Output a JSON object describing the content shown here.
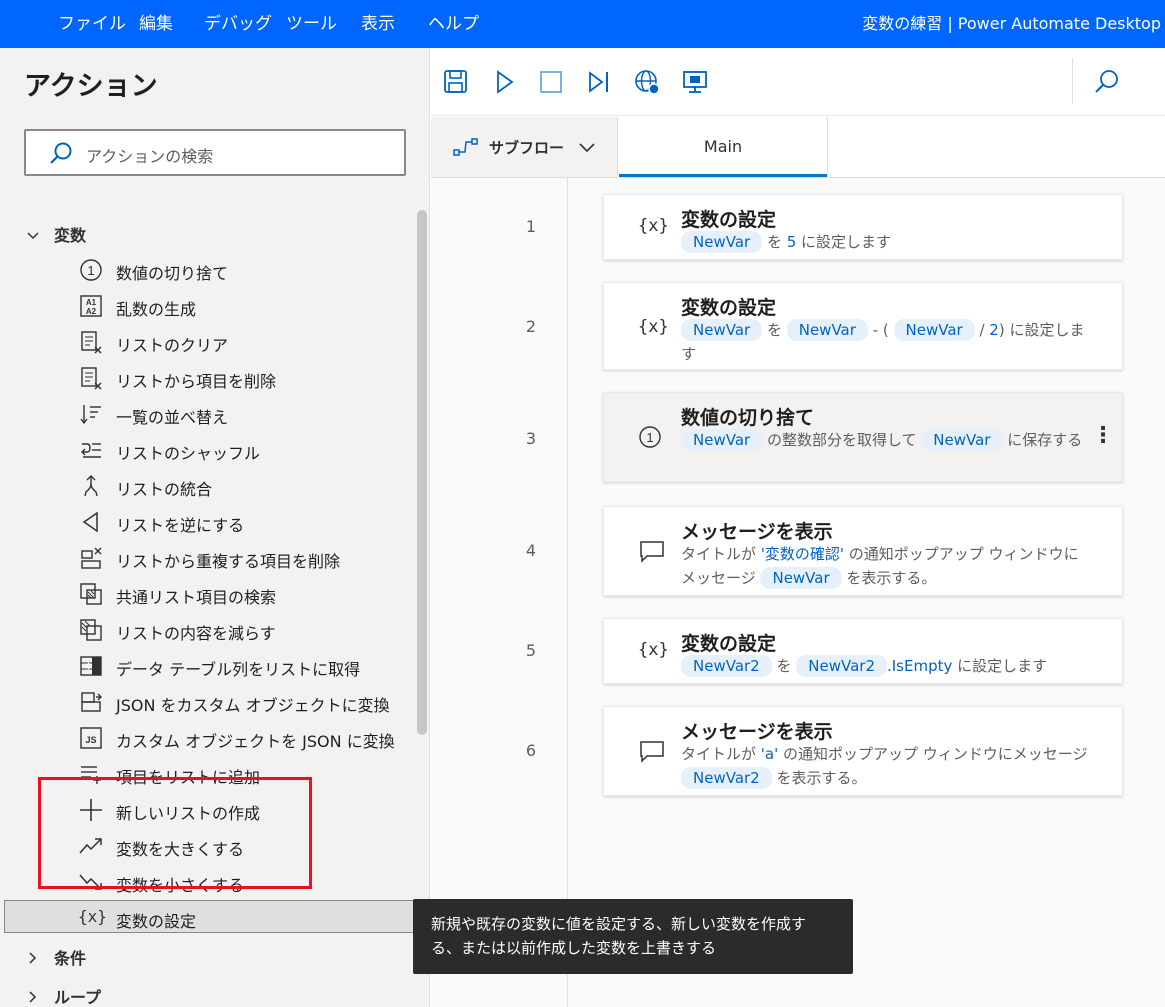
{
  "menubar": {
    "items": [
      "ファイル",
      "編集",
      "デバッグ",
      "ツール",
      "表示",
      "ヘルプ"
    ],
    "window_title": "変数の練習 | Power Automate Desktop",
    "bg_color": "#0066ff"
  },
  "actions_panel": {
    "title": "アクション",
    "search_placeholder": "アクションの検索",
    "groups": [
      {
        "label": "変数",
        "expanded": true,
        "chevron_icon": "chevron-down-icon"
      },
      {
        "label": "条件",
        "expanded": false,
        "chevron_icon": "chevron-right-icon"
      },
      {
        "label": "ループ",
        "expanded": false,
        "chevron_icon": "chevron-right-icon"
      }
    ],
    "items": [
      {
        "label": "数値の切り捨て",
        "icon": "circled-one-icon"
      },
      {
        "label": "乱数の生成",
        "icon": "random-number-icon"
      },
      {
        "label": "リストのクリア",
        "icon": "list-clear-icon"
      },
      {
        "label": "リストから項目を削除",
        "icon": "list-remove-item-icon"
      },
      {
        "label": "一覧の並べ替え",
        "icon": "sort-list-icon"
      },
      {
        "label": "リストのシャッフル",
        "icon": "shuffle-list-icon"
      },
      {
        "label": "リストの統合",
        "icon": "merge-list-icon"
      },
      {
        "label": "リストを逆にする",
        "icon": "reverse-list-icon"
      },
      {
        "label": "リストから重複する項目を削除",
        "icon": "remove-duplicates-icon"
      },
      {
        "label": "共通リスト項目の検索",
        "icon": "common-items-icon"
      },
      {
        "label": "リストの内容を減らす",
        "icon": "subtract-list-icon"
      },
      {
        "label": "データ テーブル列をリストに取得",
        "icon": "datatable-column-icon"
      },
      {
        "label": "JSON をカスタム オブジェクトに変換",
        "icon": "json-to-object-icon"
      },
      {
        "label": "カスタム オブジェクトを JSON に変換",
        "icon": "object-to-json-icon"
      },
      {
        "label": "項目をリストに追加",
        "icon": "add-to-list-icon"
      },
      {
        "label": "新しいリストの作成",
        "icon": "new-list-icon"
      },
      {
        "label": "変数を大きくする",
        "icon": "increase-variable-icon"
      },
      {
        "label": "変数を小さくする",
        "icon": "decrease-variable-icon"
      },
      {
        "label": "変数の設定",
        "icon": "set-variable-icon",
        "selected": true
      }
    ]
  },
  "toolbar": {
    "buttons": [
      "save-icon",
      "run-icon",
      "stop-icon",
      "run-next-action-icon",
      "web-recorder-icon",
      "desktop-recorder-icon",
      "search-icon"
    ]
  },
  "tabs": {
    "subflow_label": "サブフロー",
    "main_label": "Main"
  },
  "flow": {
    "steps": [
      {
        "num": "1",
        "icon": "{x}",
        "title": "変数の設定",
        "parts": [
          [
            "pill",
            "NewVar"
          ],
          [
            "text",
            " を "
          ],
          [
            "lit",
            "5"
          ],
          [
            "text",
            " に設定します"
          ]
        ]
      },
      {
        "num": "2",
        "icon": "{x}",
        "title": "変数の設定",
        "parts": [
          [
            "pill",
            "NewVar"
          ],
          [
            "text",
            " を "
          ],
          [
            "pill",
            "NewVar"
          ],
          [
            "text",
            " - ( "
          ],
          [
            "pill",
            "NewVar"
          ],
          [
            "text",
            " / "
          ],
          [
            "lit",
            "2"
          ],
          [
            "text",
            ") に設定します"
          ]
        ]
      },
      {
        "num": "3",
        "icon": "①",
        "title": "数値の切り捨て",
        "parts": [
          [
            "pill",
            "NewVar"
          ],
          [
            "text",
            " の整数部分を取得して "
          ],
          [
            "pill",
            "NewVar"
          ],
          [
            "text",
            " に保存する"
          ]
        ]
      },
      {
        "num": "4",
        "icon": "message",
        "title": "メッセージを表示",
        "parts": [
          [
            "text",
            "タイトルが "
          ],
          [
            "lit",
            "'変数の確認'"
          ],
          [
            "text",
            " の通知ポップアップ ウィンドウにメッセージ "
          ],
          [
            "pill",
            "NewVar"
          ],
          [
            "text",
            " を表示する。"
          ]
        ]
      },
      {
        "num": "5",
        "icon": "{x}",
        "title": "変数の設定",
        "parts": [
          [
            "pill",
            "NewVar2"
          ],
          [
            "text",
            " を "
          ],
          [
            "pill",
            "NewVar2"
          ],
          [
            "lit",
            ".IsEmpty"
          ],
          [
            "text",
            " に設定します"
          ]
        ]
      },
      {
        "num": "6",
        "icon": "message",
        "title": "メッセージを表示",
        "parts": [
          [
            "text",
            "タイトルが "
          ],
          [
            "lit",
            "'a'"
          ],
          [
            "text",
            " の通知ポップアップ ウィンドウにメッセージ "
          ],
          [
            "pill",
            "NewVar2"
          ],
          [
            "text",
            " を表示する。"
          ]
        ]
      }
    ]
  },
  "tooltip": {
    "text": "新規や既存の変数に値を設定する、新しい変数を作成する、または以前作成した変数を上書きする"
  },
  "colors": {
    "accent": "#0078d4",
    "pill_bg": "#e6f0fb",
    "pill_text": "#0063c2",
    "highlight_box": "#e81123"
  }
}
